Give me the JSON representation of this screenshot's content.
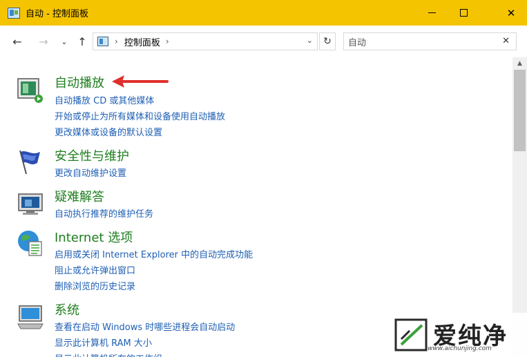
{
  "window": {
    "title": "自动 - 控制面板",
    "minimize_glyph": "",
    "close_glyph": "✕"
  },
  "address": {
    "breadcrumb": "控制面板",
    "separator": "›",
    "dropdown_glyph": "⌄",
    "refresh_glyph": "↻"
  },
  "nav": {
    "back_glyph": "←",
    "forward_glyph": "→",
    "recent_glyph": "⌄",
    "up_glyph": "↑"
  },
  "search": {
    "value": "自动",
    "clear_glyph": "✕"
  },
  "sections": [
    {
      "title": "自动播放",
      "icon": "autoplay-icon",
      "links": [
        "自动播放 CD 或其他媒体",
        "开始或停止为所有媒体和设备使用自动播放",
        "更改媒体或设备的默认设置"
      ]
    },
    {
      "title": "安全性与维护",
      "icon": "security-flag-icon",
      "links": [
        "更改自动维护设置"
      ]
    },
    {
      "title": "疑难解答",
      "icon": "troubleshoot-icon",
      "links": [
        "自动执行推荐的维护任务"
      ]
    },
    {
      "title": "Internet 选项",
      "icon": "internet-options-icon",
      "links": [
        "启用或关闭 Internet Explorer 中的自动完成功能",
        "阻止或允许弹出窗口",
        "删除浏览的历史记录"
      ]
    },
    {
      "title": "系统",
      "icon": "system-computer-icon",
      "links": [
        "查看在启动 Windows 时哪些进程会自动启动",
        "显示此计算机 RAM 大小",
        "显示此计算机所在的工作组"
      ]
    }
  ],
  "watermark": {
    "brand": "爱纯净",
    "url": "www.aichunjing.com"
  },
  "colors": {
    "titlebar": "#f5c400",
    "section_title": "#1e7e1e",
    "link": "#1e5fb3",
    "arrow": "#e0302b"
  }
}
